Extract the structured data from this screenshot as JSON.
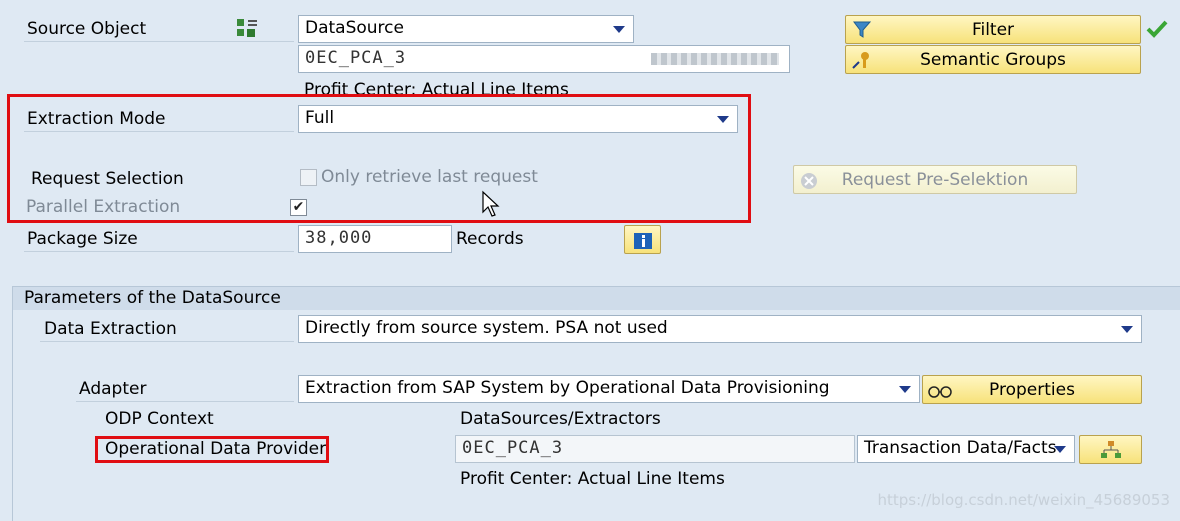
{
  "source_object": {
    "label": "Source Object",
    "type_value": "DataSource",
    "technical_name": "0EC_PCA_3",
    "description": "Profit Center: Actual Line Items",
    "filter_label": "Filter",
    "semantic_groups_label": "Semantic Groups"
  },
  "extraction": {
    "mode_label": "Extraction Mode",
    "mode_value": "Full",
    "request_selection_label": "Request Selection",
    "only_last_request_label": "Only retrieve last request",
    "request_preselection_label": "Request Pre-Selektion",
    "parallel_label": "Parallel Extraction",
    "parallel_checked": true
  },
  "package": {
    "label": "Package Size",
    "value": "38,000",
    "unit": "Records"
  },
  "parameters": {
    "section_title": "Parameters of the DataSource",
    "data_extraction_label": "Data Extraction",
    "data_extraction_value": "Directly from source system. PSA not used",
    "adapter_label": "Adapter",
    "adapter_value": "Extraction from SAP System by Operational Data Provisioning",
    "properties_label": "Properties",
    "odp_context_label": "ODP Context",
    "odp_context_value": "DataSources/Extractors",
    "odp_label": "Operational Data Provider",
    "odp_value": "0EC_PCA_3",
    "odp_type_value": "Transaction Data/Facts",
    "odp_description": "Profit Center: Actual Line Items"
  },
  "watermark": "https://blog.csdn.net/weixin_45689053",
  "colors": {
    "background": "#dfe9f3",
    "highlight_red": "#e00d12",
    "button_yellow": "#f7e27a",
    "check_green": "#3aa635",
    "dropdown_arrow": "#1f3a8a"
  }
}
